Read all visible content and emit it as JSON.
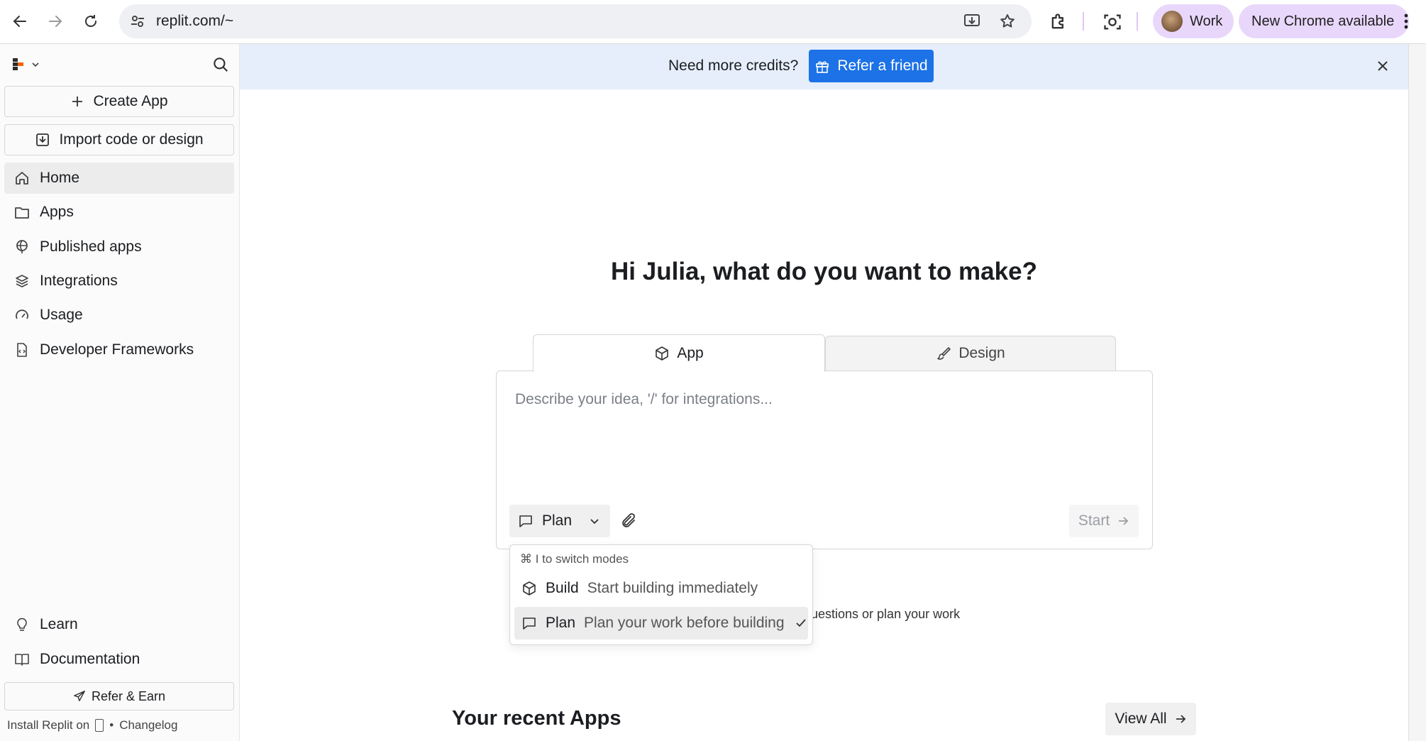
{
  "browser": {
    "url": "replit.com/~",
    "profile_label": "Work",
    "update_label": "New Chrome available"
  },
  "sidebar": {
    "create_app": "Create App",
    "import": "Import code or design",
    "nav": [
      {
        "label": "Home",
        "icon": "home-icon"
      },
      {
        "label": "Apps",
        "icon": "folder-icon"
      },
      {
        "label": "Published apps",
        "icon": "globe-icon"
      },
      {
        "label": "Integrations",
        "icon": "layers-icon"
      },
      {
        "label": "Usage",
        "icon": "gauge-icon"
      },
      {
        "label": "Developer Frameworks",
        "icon": "file-code-icon"
      }
    ],
    "bottom": [
      {
        "label": "Learn",
        "icon": "lightbulb-icon"
      },
      {
        "label": "Documentation",
        "icon": "book-icon"
      }
    ],
    "refer_earn": "Refer & Earn",
    "install_text": "Install Replit on",
    "changelog": "Changelog"
  },
  "banner": {
    "text": "Need more credits?",
    "button": "Refer a friend"
  },
  "main": {
    "greeting": "Hi Julia, what do you want to make?",
    "tabs": [
      {
        "label": "App",
        "icon": "cube-icon"
      },
      {
        "label": "Design",
        "icon": "brush-icon"
      }
    ],
    "placeholder": "Describe your idea, '/' for integrations...",
    "mode_button": "Plan",
    "start_button": "Start",
    "mode_menu": {
      "hint": "⌘ I  to switch modes",
      "items": [
        {
          "title": "Build",
          "desc": "Start building immediately"
        },
        {
          "title": "Plan",
          "desc": "Plan your work before building"
        }
      ]
    },
    "hint_behind": "uestions or plan your work",
    "recent_title": "Your recent Apps",
    "view_all": "View All"
  }
}
